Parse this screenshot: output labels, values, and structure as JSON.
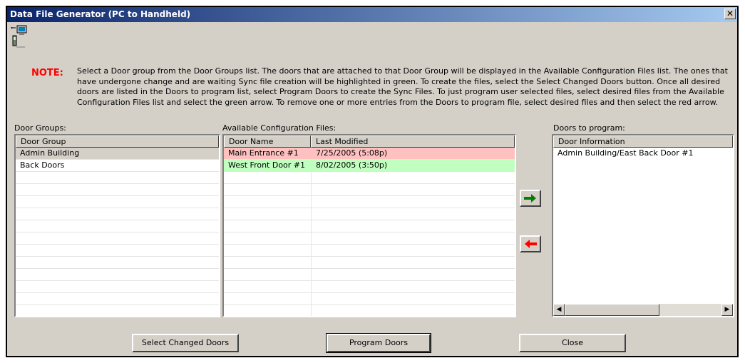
{
  "window": {
    "title": "Data File Generator (PC to Handheld)",
    "close_glyph": "✕"
  },
  "note": {
    "label": "NOTE:",
    "text": "Select a Door group from the Door Groups list. The doors that are attached to that Door Group will be displayed in the Available Configuration Files list. The ones that have undergone change and are waiting Sync file creation will be highlighted in green. To create the files, select the Select Changed Doors button. Once all desired doors are listed in the Doors to program list, select Program Doors to create the Sync Files. To just program user selected files, select desired files from the Available Configuration Files list and select the green arrow. To remove one or more entries from the Doors to program file, select desired files and then select the red arrow."
  },
  "door_groups": {
    "label": "Door Groups:",
    "column": "Door Group",
    "rows": [
      "Admin Building",
      "Back Doors"
    ]
  },
  "config_files": {
    "label": "Available Configuration Files:",
    "columns": [
      "Door Name",
      "Last Modified"
    ],
    "rows": [
      {
        "name": "Main Entrance #1",
        "modified": "7/25/2005 (5:08p)",
        "highlight": "#ffc0c0"
      },
      {
        "name": "West Front Door #1",
        "modified": "8/02/2005 (3:50p)",
        "highlight": "#c0ffc0"
      }
    ]
  },
  "doors_to_program": {
    "label": "Doors to program:",
    "column": "Door Information",
    "rows": [
      "Admin Building/East Back Door #1"
    ]
  },
  "icons": {
    "add": "green-right-arrow-icon",
    "remove": "red-left-arrow-icon",
    "app": "pc-to-handheld-icon"
  },
  "buttons": {
    "select_changed": "Select Changed Doors",
    "program": "Program Doors",
    "close": "Close"
  },
  "colors": {
    "title_bar": "#0a246a",
    "note_label": "#ff0000",
    "add_arrow": "#008000",
    "remove_arrow": "#ff0000"
  }
}
